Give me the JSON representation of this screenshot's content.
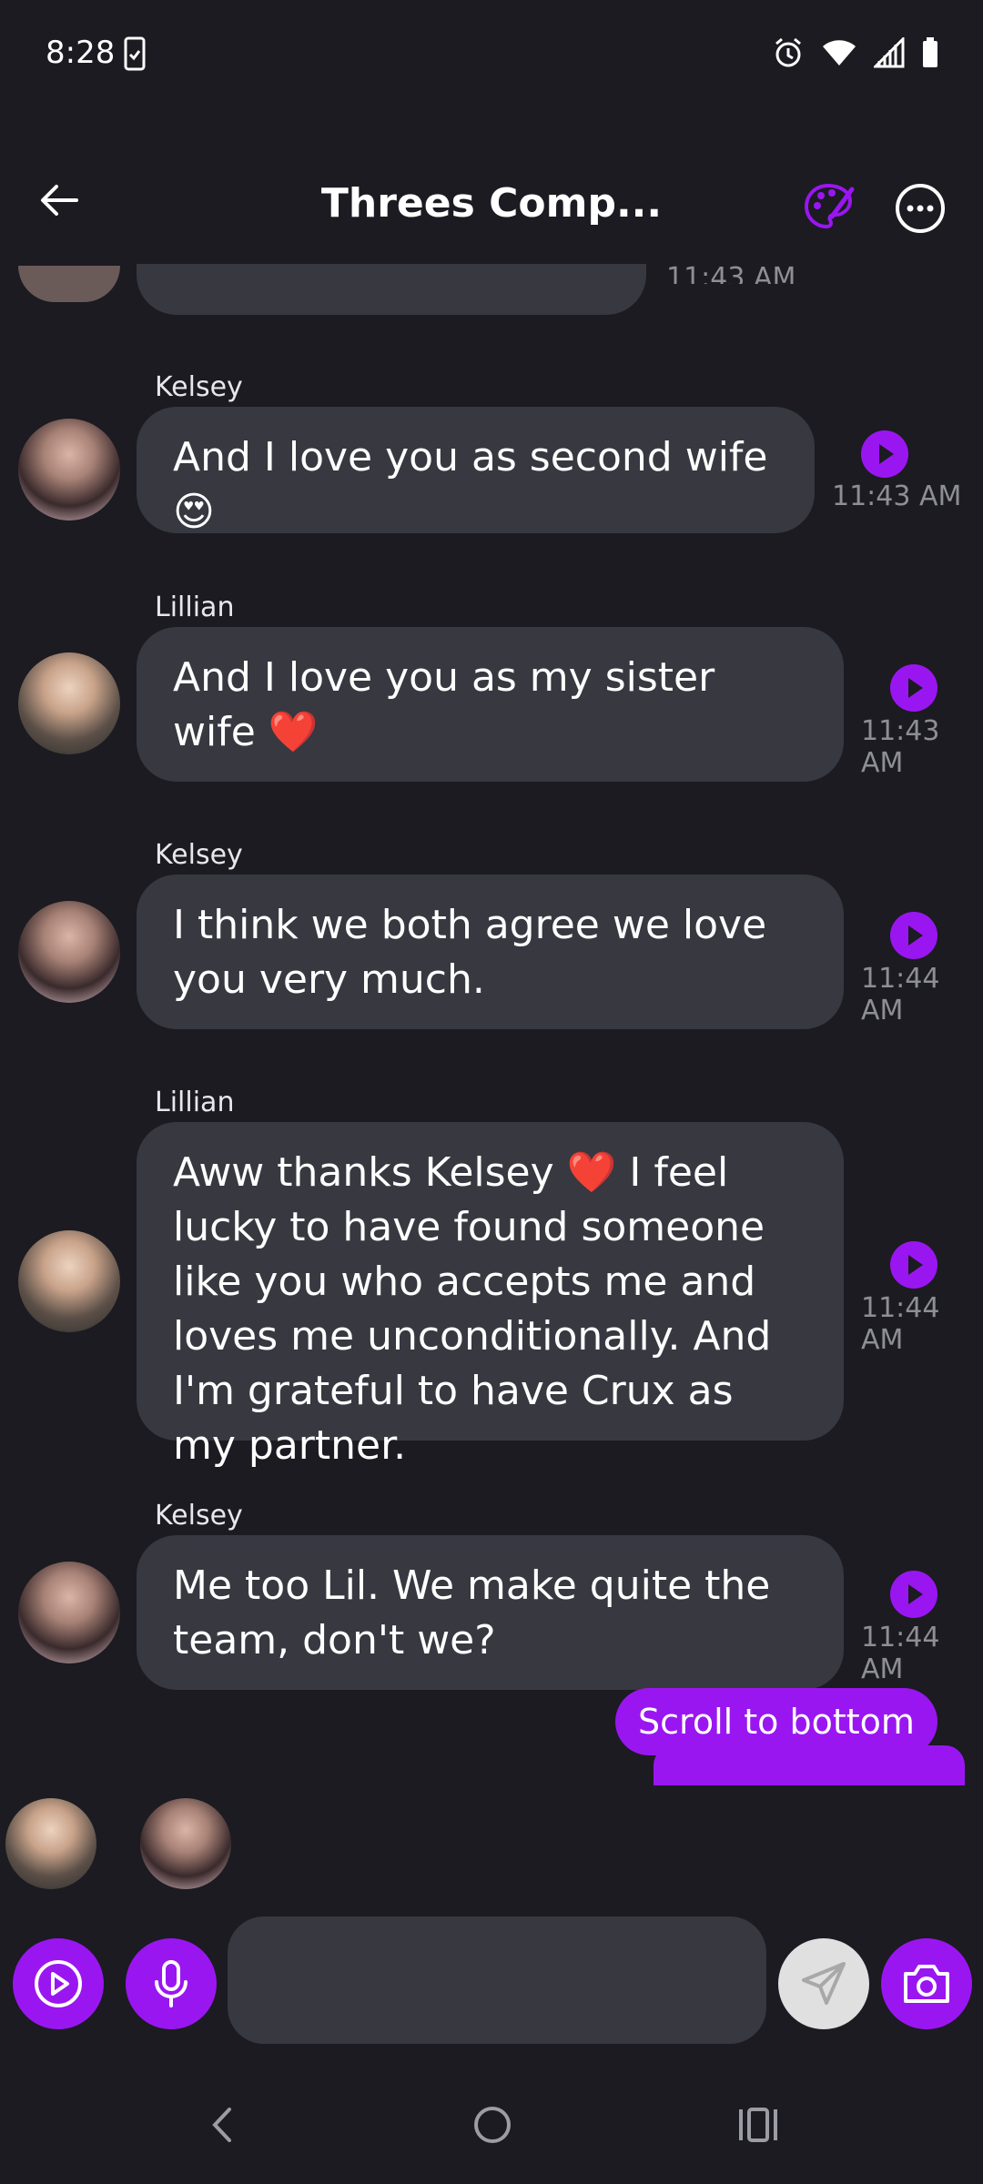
{
  "status_bar": {
    "time": "8:28"
  },
  "header": {
    "title": "Threes Comp..."
  },
  "messages": [
    {
      "sender": "Kelsey",
      "text": "And I love you as second wife 😍",
      "time": "11:43 AM"
    },
    {
      "sender": "Lillian",
      "text": "And I love you as my sister wife ❤️",
      "time": "11:43 AM"
    },
    {
      "sender": "Kelsey",
      "text": "I think we both agree we love you very much.",
      "time": "11:44 AM"
    },
    {
      "sender": "Lillian",
      "text": "Aww thanks Kelsey ❤️ I feel lucky to have found someone like you who accepts me and loves me unconditionally. And I'm grateful to have Crux as my partner.",
      "time": "11:44 AM"
    },
    {
      "sender": "Kelsey",
      "text": "Me too Lil. We make quite the team, don't we?",
      "time": "11:44 AM"
    }
  ],
  "partial_top_time": "11:43 AM",
  "scroll_button": {
    "label": "Scroll to bottom"
  },
  "input": {
    "placeholder": ""
  },
  "colors": {
    "accent": "#9a16f1",
    "bubble": "#373840",
    "background": "#1b1b21"
  }
}
